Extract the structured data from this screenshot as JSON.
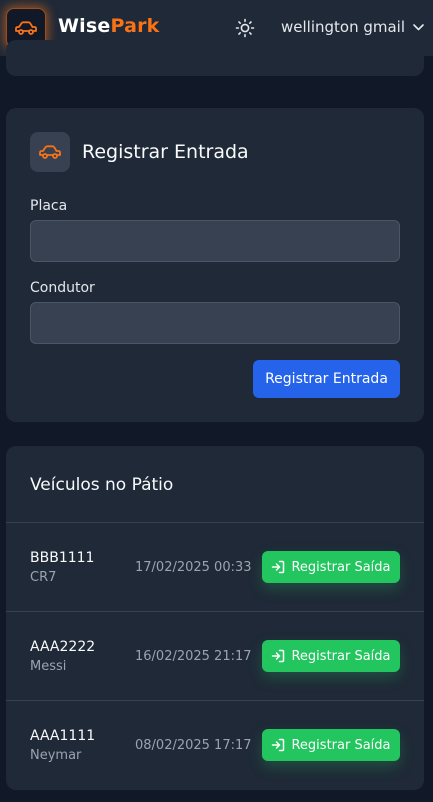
{
  "header": {
    "brand_part1": "Wise",
    "brand_part2": "Park",
    "user_name": "wellington gmail",
    "icons": [
      "car-icon",
      "sun-icon",
      "chevron-down-icon"
    ]
  },
  "entry": {
    "title": "Registrar Entrada",
    "plate_label": "Placa",
    "plate_value": "",
    "driver_label": "Condutor",
    "driver_value": "",
    "submit_label": "Registrar Entrada"
  },
  "vehicles": {
    "title": "Veículos no Pátio",
    "exit_label": "Registrar Saída",
    "rows": [
      {
        "plate": "BBB1111",
        "driver": "CR7",
        "timestamp": "17/02/2025 00:33"
      },
      {
        "plate": "AAA2222",
        "driver": "Messi",
        "timestamp": "16/02/2025 21:17"
      },
      {
        "plate": "AAA1111",
        "driver": "Neymar",
        "timestamp": "08/02/2025 17:17"
      }
    ]
  },
  "colors": {
    "accent": "#f97316",
    "primary": "#2563eb",
    "success": "#22c55e",
    "background": "#111827",
    "card": "#1f2937"
  }
}
